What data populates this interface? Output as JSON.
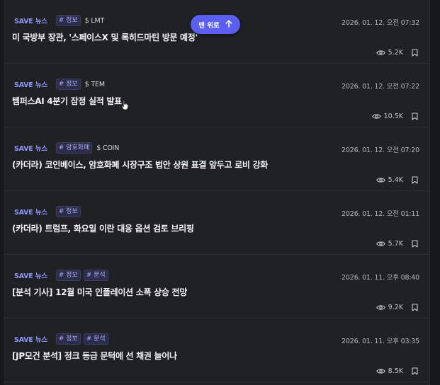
{
  "top_button": {
    "label": "맨 위로",
    "icon": "arrow-up-icon"
  },
  "colors": {
    "accent": "#5b5fef",
    "tag_text": "#a9acff",
    "source_text": "#8f95ff",
    "background": "#202125"
  },
  "news": [
    {
      "source": "SAVE 뉴스",
      "tags": [
        "# 정보"
      ],
      "ticker": "$ LMT",
      "date": "2026. 01. 12. 오전 07:32",
      "title": "미 국방부 장관, '스페이스X 및 록히드마틴 방문 예정'",
      "views": "5.2K"
    },
    {
      "source": "SAVE 뉴스",
      "tags": [
        "# 정보"
      ],
      "ticker": "$ TEM",
      "date": "2026. 01. 12. 오전 07:22",
      "title": "템퍼스AI 4분기 잠정 실적 발표",
      "views": "10.5K"
    },
    {
      "source": "SAVE 뉴스",
      "tags": [
        "# 암호화폐"
      ],
      "ticker": "$ COIN",
      "date": "2026. 01. 12. 오전 07:20",
      "title": "(카더라) 코인베이스, 암호화폐 시장구조 법안 상원 표결 앞두고 로비 강화",
      "views": "5.4K"
    },
    {
      "source": "SAVE 뉴스",
      "tags": [
        "# 정보"
      ],
      "ticker": "",
      "date": "2026. 01. 12. 오전 01:11",
      "title": "(카더라) 트럼프, 화요일 이란 대응 옵션 검토 브리핑",
      "views": "5.7K"
    },
    {
      "source": "SAVE 뉴스",
      "tags": [
        "# 정보",
        "# 분석"
      ],
      "ticker": "",
      "date": "2026. 01. 11. 오후 08:40",
      "title": "[분석 기사] 12월 미국 인플레이션 소폭 상승 전망",
      "views": "9.2K"
    },
    {
      "source": "SAVE 뉴스",
      "tags": [
        "# 정보",
        "# 분석"
      ],
      "ticker": "",
      "date": "2026. 01. 11. 오후 03:35",
      "title": "[JP모건 분석] 정크 등급 문턱에 선 채권 늘어나",
      "views": "8.5K"
    }
  ]
}
